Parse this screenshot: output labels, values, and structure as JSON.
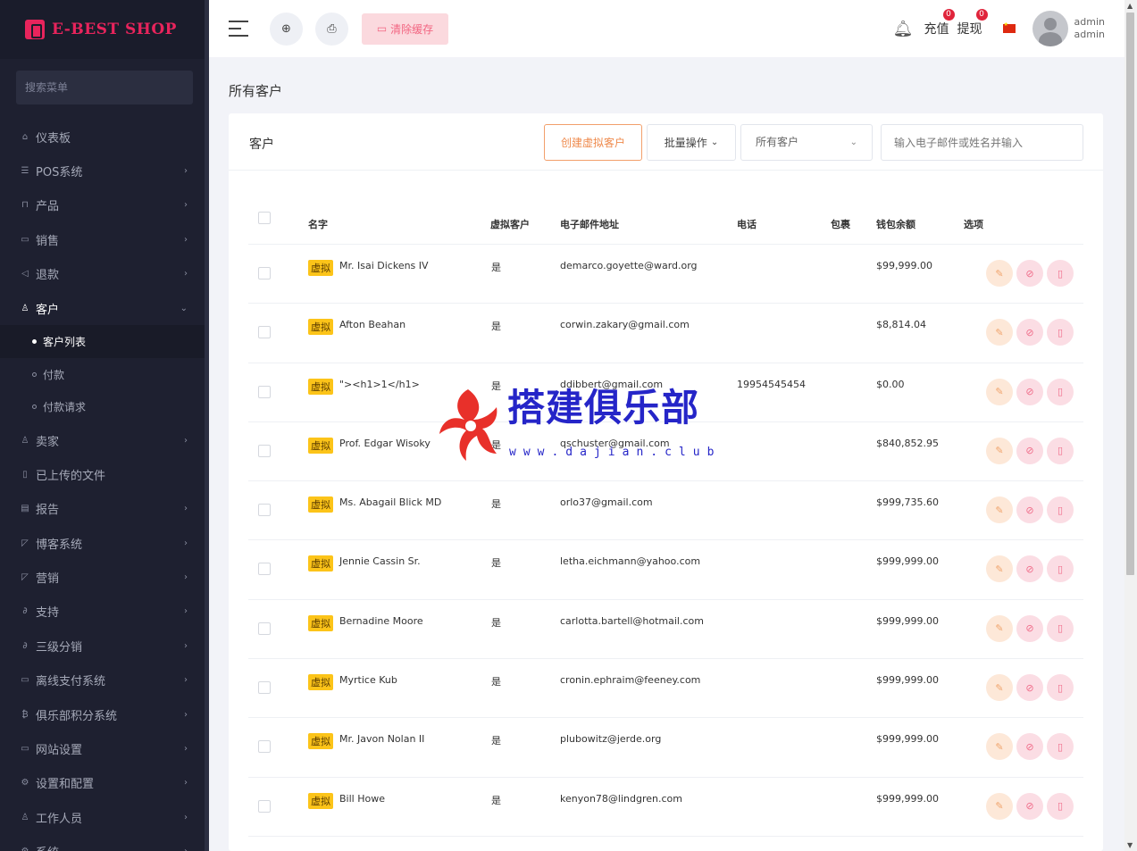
{
  "brand": {
    "name": "E-BEST SHOP",
    "accent": "#e8245c"
  },
  "sidebar": {
    "search_placeholder": "搜索菜单",
    "items": [
      {
        "label": "仪表板",
        "icon": "home-icon",
        "glyph": "⌂",
        "chevron": ""
      },
      {
        "label": "POS系统",
        "icon": "list-icon",
        "glyph": "☰",
        "chevron": "›"
      },
      {
        "label": "产品",
        "icon": "cart-icon",
        "glyph": "⊓",
        "chevron": "›"
      },
      {
        "label": "销售",
        "icon": "card-icon",
        "glyph": "▭",
        "chevron": "›"
      },
      {
        "label": "退款",
        "icon": "return-icon",
        "glyph": "◁",
        "chevron": "›"
      },
      {
        "label": "客户",
        "icon": "users-icon",
        "glyph": "♙",
        "chevron": "⌄",
        "open": true
      },
      {
        "label": "卖家",
        "icon": "seller-icon",
        "glyph": "♙",
        "chevron": "›"
      },
      {
        "label": "已上传的文件",
        "icon": "file-icon",
        "glyph": "▯",
        "chevron": ""
      },
      {
        "label": "报告",
        "icon": "report-icon",
        "glyph": "▤",
        "chevron": "›"
      },
      {
        "label": "博客系统",
        "icon": "blog-icon",
        "glyph": "◸",
        "chevron": "›"
      },
      {
        "label": "营销",
        "icon": "marketing-icon",
        "glyph": "◸",
        "chevron": "›"
      },
      {
        "label": "支持",
        "icon": "link-icon",
        "glyph": "∂",
        "chevron": "›"
      },
      {
        "label": "三级分销",
        "icon": "affiliate-icon",
        "glyph": "∂",
        "chevron": "›"
      },
      {
        "label": "离线支付系统",
        "icon": "offline-pay-icon",
        "glyph": "▭",
        "chevron": "›"
      },
      {
        "label": "俱乐部积分系统",
        "icon": "points-icon",
        "glyph": "₿",
        "chevron": "›"
      },
      {
        "label": "网站设置",
        "icon": "monitor-icon",
        "glyph": "▭",
        "chevron": "›"
      },
      {
        "label": "设置和配置",
        "icon": "settings-icon",
        "glyph": "⚙",
        "chevron": "›"
      },
      {
        "label": "工作人员",
        "icon": "staff-icon",
        "glyph": "♙",
        "chevron": "›"
      },
      {
        "label": "系统",
        "icon": "system-icon",
        "glyph": "⚙",
        "chevron": "›"
      }
    ],
    "sub_items": [
      {
        "label": "客户列表",
        "active": true
      },
      {
        "label": "付款",
        "active": false
      },
      {
        "label": "付款请求",
        "active": false
      }
    ]
  },
  "topbar": {
    "clear_cache": "清除缓存",
    "recharge": "充值",
    "recharge_badge": "0",
    "withdraw": "提现",
    "withdraw_badge": "0",
    "user_name": "admin",
    "user_role": "admin"
  },
  "page": {
    "title": "所有客户"
  },
  "card": {
    "title": "客户",
    "create_button": "创建虚拟客户",
    "bulk_button": "批量操作",
    "filter_value": "所有客户",
    "search_placeholder": "输入电子邮件或姓名并输入"
  },
  "table": {
    "headers": {
      "name": "名字",
      "virtual": "虚拟客户",
      "email": "电子邮件地址",
      "phone": "电话",
      "package": "包裹",
      "wallet": "钱包余额",
      "options": "选项"
    },
    "tag": "虚拟",
    "rows": [
      {
        "name": "Mr. Isai Dickens IV",
        "virtual": "是",
        "email": "demarco.goyette@ward.org",
        "phone": "",
        "package": "",
        "wallet": "$99,999.00"
      },
      {
        "name": "Afton Beahan",
        "virtual": "是",
        "email": "corwin.zakary@gmail.com",
        "phone": "",
        "package": "",
        "wallet": "$8,814.04"
      },
      {
        "name": "\"><h1>1</h1>",
        "virtual": "是",
        "email": "ddibbert@gmail.com",
        "phone": "19954545454",
        "package": "",
        "wallet": "$0.00"
      },
      {
        "name": "Prof. Edgar Wisoky",
        "virtual": "是",
        "email": "qschuster@gmail.com",
        "phone": "",
        "package": "",
        "wallet": "$840,852.95"
      },
      {
        "name": "Ms. Abagail Blick MD",
        "virtual": "是",
        "email": "orlo37@gmail.com",
        "phone": "",
        "package": "",
        "wallet": "$999,735.60"
      },
      {
        "name": "Jennie Cassin Sr.",
        "virtual": "是",
        "email": "letha.eichmann@yahoo.com",
        "phone": "",
        "package": "",
        "wallet": "$999,999.00"
      },
      {
        "name": "Bernadine Moore",
        "virtual": "是",
        "email": "carlotta.bartell@hotmail.com",
        "phone": "",
        "package": "",
        "wallet": "$999,999.00"
      },
      {
        "name": "Myrtice Kub",
        "virtual": "是",
        "email": "cronin.ephraim@feeney.com",
        "phone": "",
        "package": "",
        "wallet": "$999,999.00"
      },
      {
        "name": "Mr. Javon Nolan II",
        "virtual": "是",
        "email": "plubowitz@jerde.org",
        "phone": "",
        "package": "",
        "wallet": "$999,999.00"
      },
      {
        "name": "Bill Howe",
        "virtual": "是",
        "email": "kenyon78@lindgren.com",
        "phone": "",
        "package": "",
        "wallet": "$999,999.00"
      }
    ]
  },
  "watermark": {
    "cn": "搭建俱乐部",
    "en": "www.dajian.club"
  }
}
